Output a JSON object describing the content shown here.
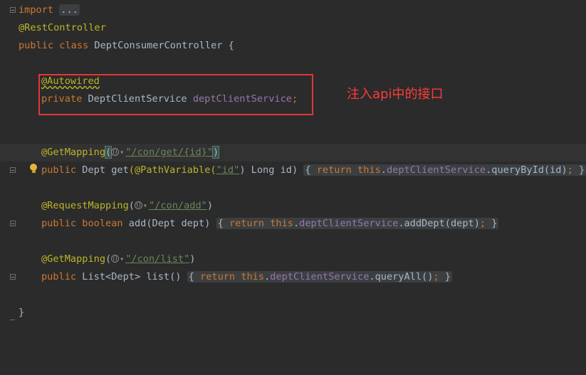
{
  "editor": {
    "lines": {
      "l1": {
        "kw": "import",
        "fold": "..."
      },
      "l2": {
        "ann": "@RestController"
      },
      "l3": {
        "kw1": "public",
        "kw2": "class",
        "name": "DeptConsumerController",
        "brace": "{"
      },
      "l5": {
        "ann": "@Autowired"
      },
      "l6": {
        "kw": "private",
        "type": "DeptClientService",
        "field": "deptClientService",
        "semi": ";"
      },
      "l9": {
        "ann": "@GetMapping",
        "open": "(",
        "str": "\"/con/get/{id}\"",
        "close": ")"
      },
      "l10": {
        "kw": "public",
        "type": "Dept",
        "method": "get",
        "param_ann": "(@PathVariable(",
        "param_str": "\"id\"",
        "param_rest": ") Long id)",
        "body_kw1": "return",
        "body_kw2": "this",
        "body_field": "deptClientService",
        "body_call": ".queryById(id)",
        "lbrace": "{",
        "rbrace": "}"
      },
      "l12": {
        "ann": "@RequestMapping",
        "open": "(",
        "str": "\"/con/add\"",
        "close": ")"
      },
      "l13": {
        "kw1": "public",
        "kw2": "boolean",
        "method": "add",
        "params": "(Dept dept)",
        "body_kw1": "return",
        "body_kw2": "this",
        "body_field": "deptClientService",
        "body_call": ".addDept(dept)",
        "lbrace": "{",
        "rbrace": "}"
      },
      "l15": {
        "ann": "@GetMapping",
        "open": "(",
        "str": "\"/con/list\"",
        "close": ")"
      },
      "l16": {
        "kw": "public",
        "type": "List<Dept>",
        "method": "list",
        "params": "()",
        "body_kw1": "return",
        "body_kw2": "this",
        "body_field": "deptClientService",
        "body_call": ".queryAll()",
        "lbrace": "{",
        "rbrace": "}"
      },
      "l18": {
        "brace": "}"
      }
    }
  },
  "annotation_note": "注入api中的接口",
  "colors": {
    "background": "#2b2b2b",
    "keyword": "#cc7832",
    "annotation": "#bbb529",
    "string": "#6a8759",
    "field": "#9876aa",
    "text": "#a9b7c6",
    "highlight_box": "#e5353a",
    "note_text": "#ff3b3b"
  },
  "icons": [
    "fold-toggle-icon",
    "web-endpoint-icon",
    "chevron-down-icon",
    "lightbulb-icon"
  ]
}
